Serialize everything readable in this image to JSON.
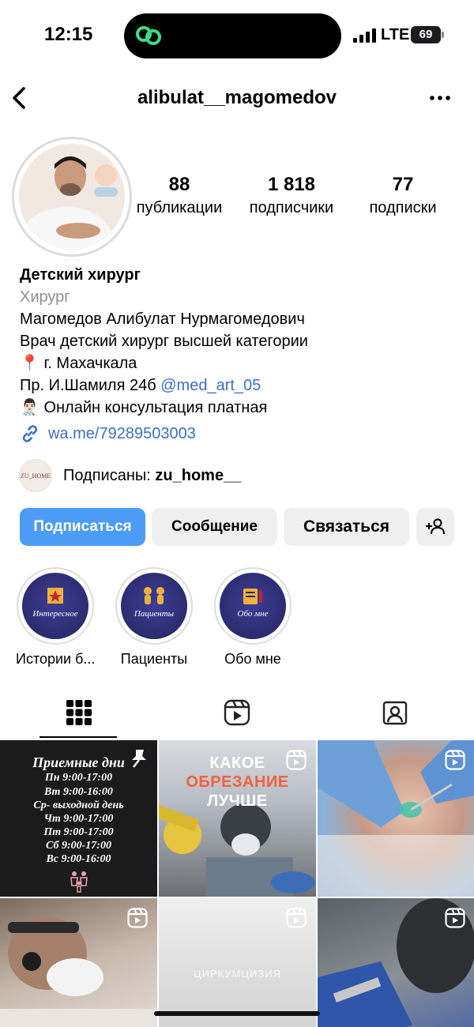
{
  "status_bar": {
    "time": "12:15",
    "network": "LTE",
    "battery": "69"
  },
  "header": {
    "username": "alibulat__magomedov"
  },
  "stats": [
    {
      "value": "88",
      "label": "публикации"
    },
    {
      "value": "1 818",
      "label": "подписчики"
    },
    {
      "value": "77",
      "label": "подписки"
    }
  ],
  "bio": {
    "name": "Детский хирург",
    "category": "Хирург",
    "lines": [
      "Магомедов Алибулат Нурмагомедович",
      "Врач детский хирург высшей категории",
      "📍 г. Махачкала",
      "Пр. И.Шамиля 24б"
    ],
    "mention": "@med_art_05",
    "consult": "👨🏻‍⚕️ Онлайн консультация платная",
    "link": "wa.me/79289503003"
  },
  "followed_by": {
    "prefix": "Подписаны:",
    "account": "zu_home__",
    "avatar_text": "ZU_HOME"
  },
  "buttons": {
    "follow": "Подписаться",
    "message": "Сообщение",
    "contact": "Связаться"
  },
  "highlights": [
    {
      "label": "Истории б...",
      "inner_text": "Интересное"
    },
    {
      "label": "Пациенты",
      "inner_text": "Пациенты"
    },
    {
      "label": "Обо мне",
      "inner_text": "Обо мне"
    }
  ],
  "posts": {
    "schedule": {
      "title": "Приемные дни",
      "lines": [
        "Пн 9:00-17:00",
        "Вт 9:00-16:00",
        "Ср- выходной день",
        "Чт 9:00-17:00",
        "Пт 9:00-17:00",
        "Сб 9:00-17:00",
        "Вс 9:00-16:00"
      ]
    },
    "reel_title": [
      "КАКОЕ",
      "ОБРЕЗАНИЕ",
      "ЛУЧШЕ"
    ],
    "faded_text": "ЦИРКУМЦИЗИЯ"
  },
  "colors": {
    "accent": "#4c9bf5",
    "link": "#3b6fc7",
    "muted": "#8e8e8e"
  }
}
